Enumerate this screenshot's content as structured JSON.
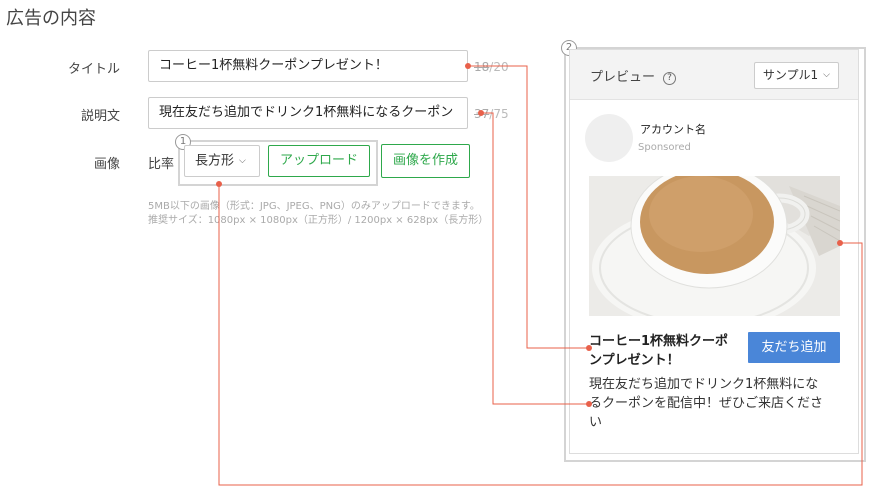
{
  "page": {
    "heading": "広告の内容"
  },
  "form": {
    "title_label": "タイトル",
    "title_value": "コーヒー1杯無料クーポンプレゼント！",
    "title_count": "18",
    "title_max": "/20",
    "desc_label": "説明文",
    "desc_value": "現在友だち追加でドリンク1杯無料になるクーポン",
    "desc_count": "37",
    "desc_max": "/75",
    "image_label": "画像",
    "ratio_label": "比率",
    "ratio_value": "長方形",
    "upload_label": "アップロード",
    "create_label": "画像を作成",
    "note_line1": "5MB以下の画像（形式：JPG、JPEG、PNG）のみアップロードできます。",
    "note_line2": "推奨サイズ：1080px × 1080px（正方形）/ 1200px × 628px（長方形）"
  },
  "callouts": {
    "one": "1",
    "two": "2"
  },
  "preview": {
    "title": "プレビュー",
    "help_glyph": "?",
    "sample_value": "サンプル1",
    "account_name": "アカウント名",
    "sponsored": "Sponsored",
    "ad_title_line1": "コーヒー1杯無料クーポ",
    "ad_title_line2": "ンプレゼント！",
    "add_friend": "友だち追加",
    "desc_line1": "現在友だち追加でドリンク1杯無料にな",
    "desc_line2": "るクーポンを配信中！ぜひご来店くださ",
    "desc_line3": "い"
  },
  "colors": {
    "accent_green": "#2ea84b",
    "button_blue": "#4a86d8",
    "connector_red": "#e8604a",
    "callout_gray": "#d4d4d4"
  },
  "icons": [
    "help-circle-icon",
    "chevron-down-icon",
    "coffee-cup-photo"
  ]
}
